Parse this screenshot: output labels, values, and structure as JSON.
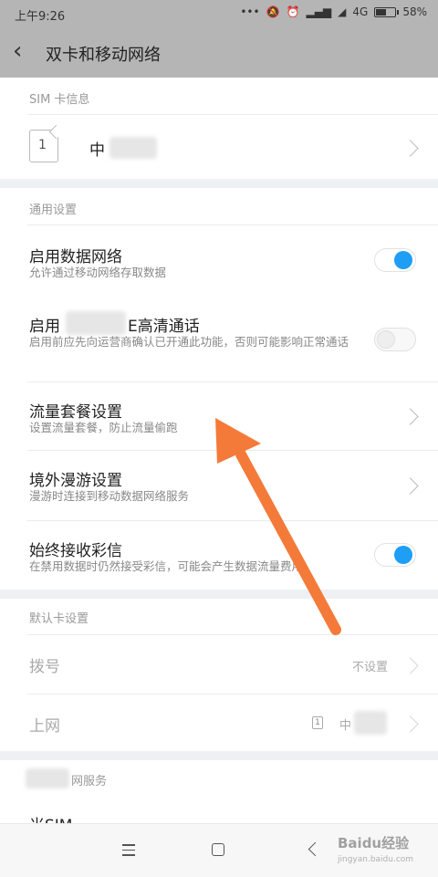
{
  "status_bar": {
    "time": "上午9:26",
    "network": "4G",
    "battery": "58%",
    "battery_level": 0.58,
    "icons": [
      "more-icon",
      "mute-icon",
      "alarm-icon",
      "signal-icon",
      "wifi-icon",
      "battery-icon"
    ]
  },
  "header": {
    "title": "双卡和移动网络"
  },
  "sim_info": {
    "section": "SIM 卡信息",
    "slot": "1",
    "carrier": "中"
  },
  "general": {
    "section": "通用设置",
    "data_network": {
      "title": "启用数据网络",
      "subtitle": "允许通过移动网络存取数据",
      "enabled": true
    },
    "hd_call": {
      "title_a": "启用",
      "title_b": "E高清通话",
      "subtitle": "启用前应先向运营商确认已开通此功能，否则可能影响正常通话",
      "enabled": false
    },
    "data_plan": {
      "title": "流量套餐设置",
      "subtitle": "设置流量套餐，防止流量偷跑"
    },
    "roaming": {
      "title": "境外漫游设置",
      "subtitle": "漫游时连接到移动数据网络服务"
    },
    "mms": {
      "title": "始终接收彩信",
      "subtitle": "在禁用数据时仍然接受彩信，可能会产生数据流量费用",
      "enabled": true
    }
  },
  "default_card": {
    "section": "默认卡设置",
    "dial": {
      "title": "拨号",
      "value": "不设置"
    },
    "internet": {
      "title": "上网",
      "sim_slot": "1",
      "value": "中"
    }
  },
  "services": {
    "section": "网服务",
    "mi_sim": "米SIM"
  },
  "watermark": {
    "brand": "Baidu经验",
    "url": "jingyan.baidu.com"
  },
  "colors": {
    "accent": "#1e9ef4",
    "arrow": "#f47a3a",
    "header_bg": "#b5b5b5"
  }
}
